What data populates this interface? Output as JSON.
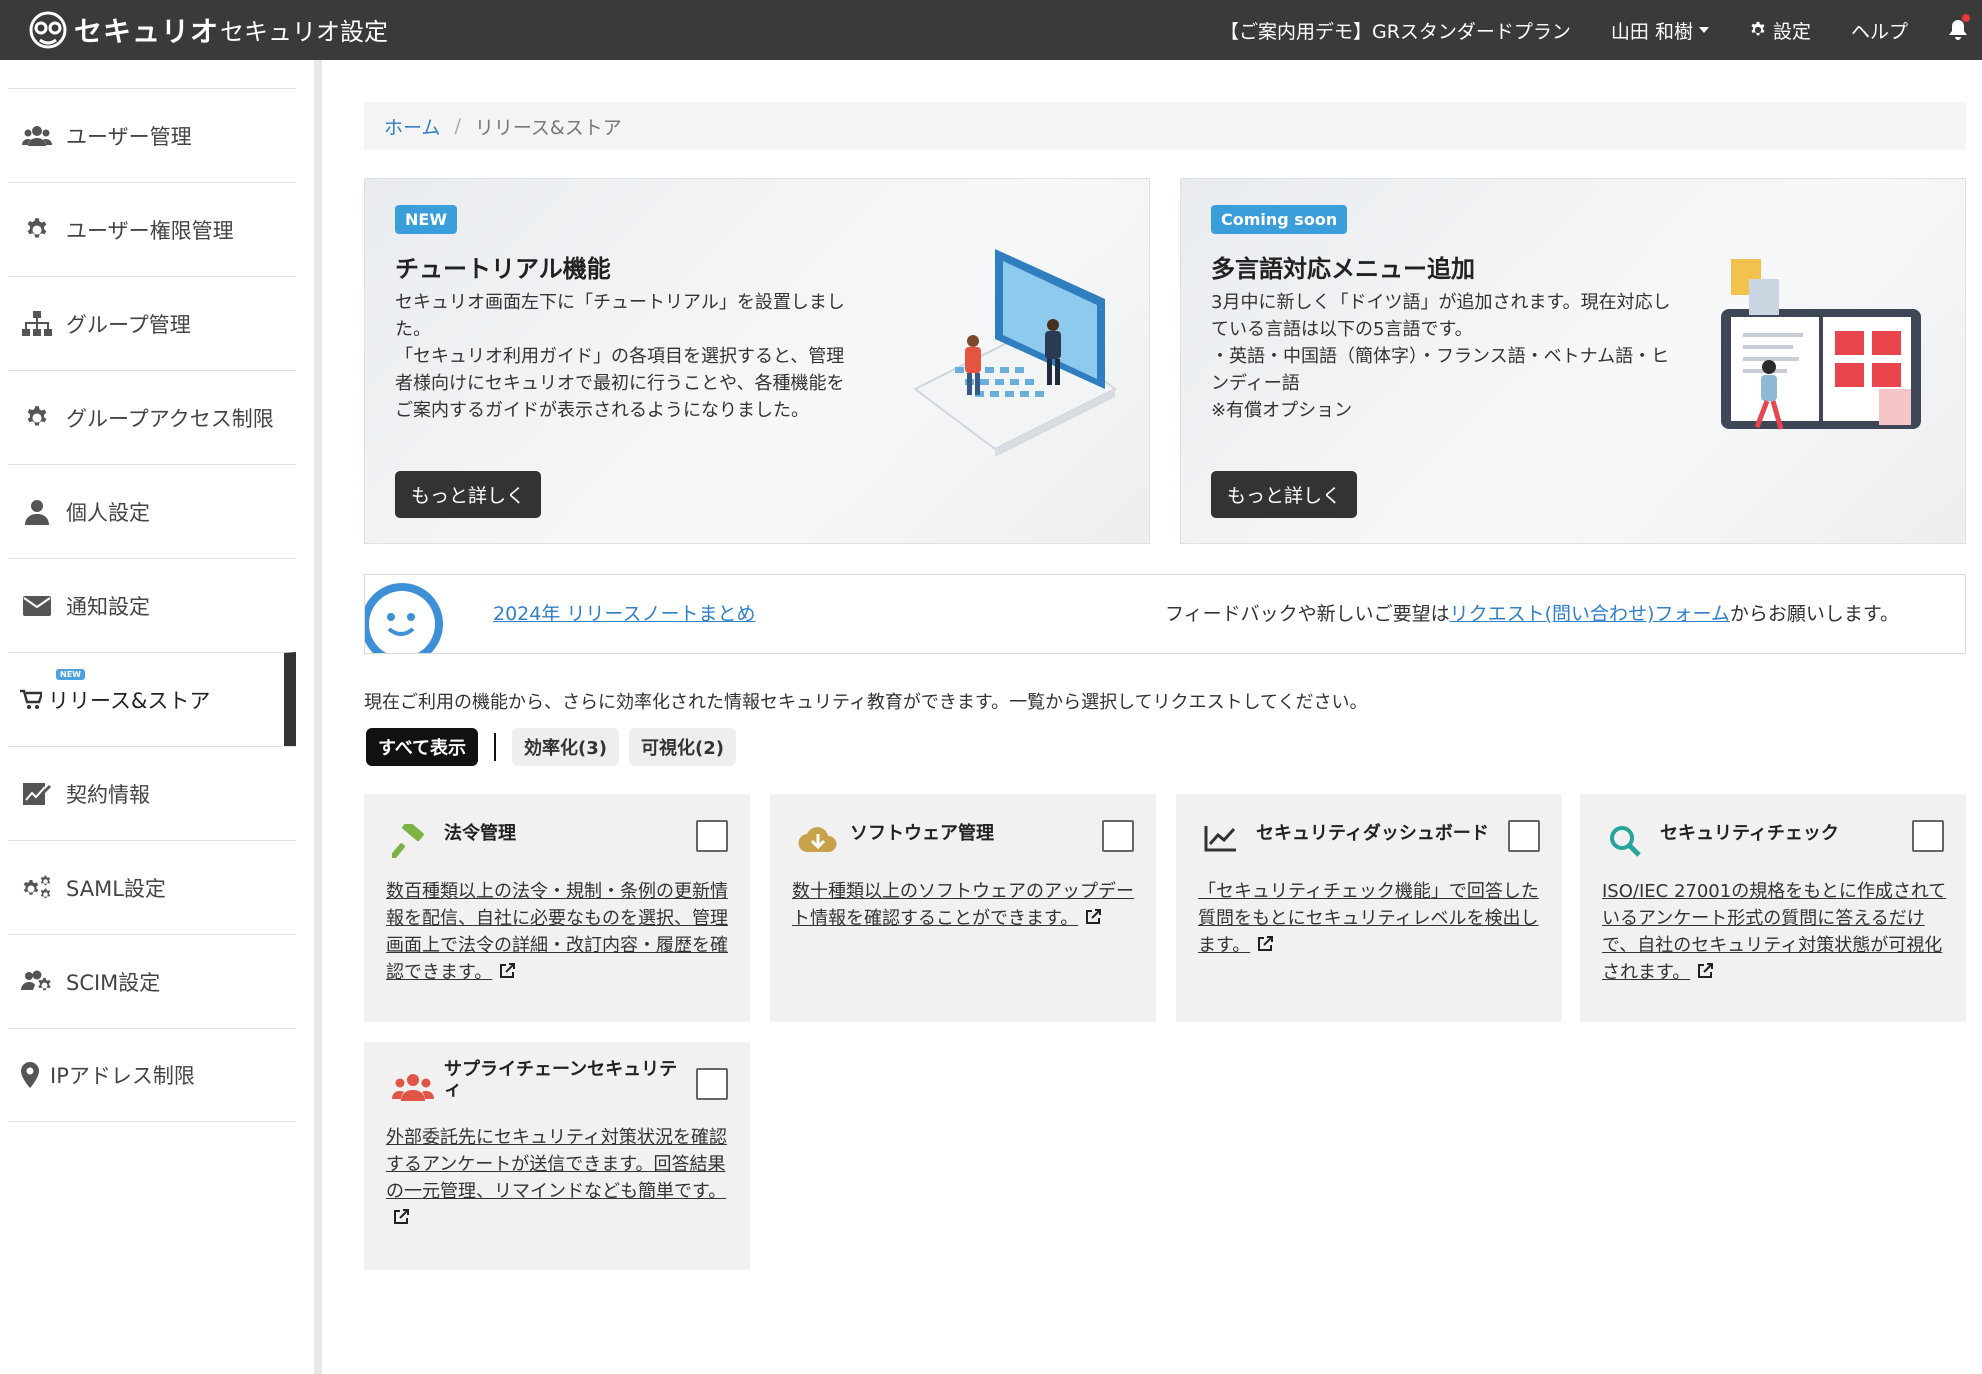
{
  "header": {
    "logo_text": "セキュリオ",
    "app_title": "セキュリオ設定",
    "plan": "【ご案内用デモ】GRスタンダードプラン",
    "user_name": "山田 和樹",
    "settings_label": "設定",
    "help_label": "ヘルプ"
  },
  "sidebar": {
    "items": [
      {
        "label": "ユーザー管理"
      },
      {
        "label": "ユーザー権限管理"
      },
      {
        "label": "グループ管理"
      },
      {
        "label": "グループアクセス制限"
      },
      {
        "label": "個人設定"
      },
      {
        "label": "通知設定"
      },
      {
        "label": "リリース&ストア",
        "badge": "NEW"
      },
      {
        "label": "契約情報"
      },
      {
        "label": "SAML設定"
      },
      {
        "label": "SCIM設定"
      },
      {
        "label": "IPアドレス制限"
      }
    ]
  },
  "breadcrumb": {
    "home": "ホーム",
    "separator": "/",
    "current": "リリース&ストア"
  },
  "promos": [
    {
      "badge": "NEW",
      "title": "チュートリアル機能",
      "desc": "セキュリオ画面左下に「チュートリアル」を設置しました。\n「セキュリオ利用ガイド」の各項目を選択すると、管理者様向けにセキュリオで最初に行うことや、各種機能をご案内するガイドが表示されるようになりました。",
      "button": "もっと詳しく"
    },
    {
      "badge": "Coming soon",
      "title": "多言語対応メニュー追加",
      "desc": "3月中に新しく「ドイツ語」が追加されます。現在対応している言語は以下の5言語です。\n・英語・中国語（簡体字）・フランス語・ベトナム語・ヒンディー語\n※有償オプション",
      "button": "もっと詳しく"
    }
  ],
  "notice": {
    "release_note_link": "2024年 リリースノートまとめ",
    "feedback_prefix": "フィードバックや新しいご要望は",
    "feedback_link": "リクエスト(問い合わせ)フォーム",
    "feedback_suffix": "からお願いします。"
  },
  "intro": "現在ご利用の機能から、さらに効率化された情報セキュリティ教育ができます。一覧から選択してリクエストしてください。",
  "filters": [
    "すべて表示",
    "効率化(3)",
    "可視化(2)"
  ],
  "cards": [
    {
      "title": "法令管理",
      "icon": "gavel-icon",
      "color": "#7cb342",
      "desc": "数百種類以上の法令・規制・条例の更新情報を配信、自社に必要なものを選択、管理画面上で法令の詳細・改訂内容・履歴を確認できます。"
    },
    {
      "title": "ソフトウェア管理",
      "icon": "cloud-download-icon",
      "color": "#c8a24a",
      "desc": "数十種類以上のソフトウェアのアップデート情報を確認することができます。"
    },
    {
      "title": "セキュリティダッシュボード",
      "icon": "chart-line-icon",
      "color": "#333333",
      "desc": "「セキュリティチェック機能」で回答した質問をもとにセキュリティレベルを検出します。"
    },
    {
      "title": "セキュリティチェック",
      "icon": "search-icon",
      "color": "#26a69a",
      "desc": "ISO/IEC 27001の規格をもとに作成されているアンケート形式の質問に答えるだけで、自社のセキュリティ対策状態が可視化されます。"
    },
    {
      "title": "サプライチェーンセキュリティ",
      "icon": "users-icon",
      "color": "#e05545",
      "desc": "外部委託先にセキュリティ対策状況を確認するアンケートが送信できます。回答結果の一元管理、リマインドなども簡単です。"
    }
  ]
}
